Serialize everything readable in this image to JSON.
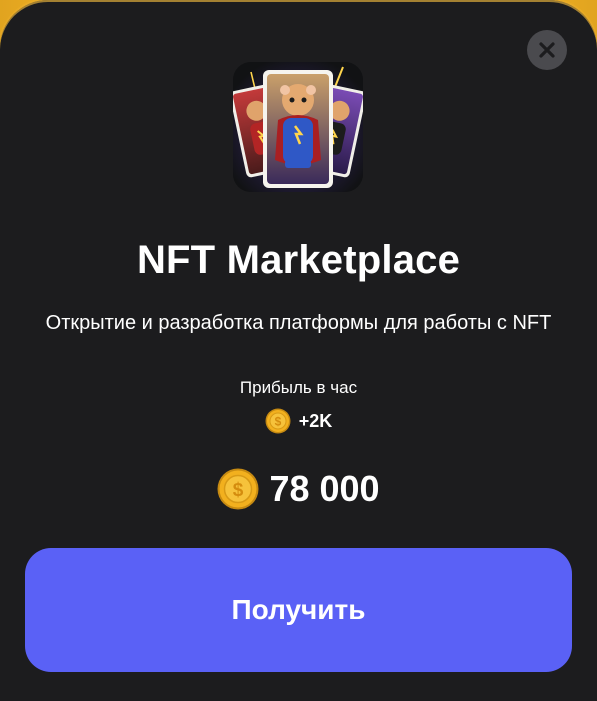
{
  "modal": {
    "title": "NFT Marketplace",
    "description": "Открытие и разработка платформы для работы с NFT",
    "profit_label": "Прибыль в час",
    "profit_value": "+2K",
    "price": "78 000",
    "cta_label": "Получить"
  },
  "icons": {
    "close": "close-icon",
    "coin": "coin-icon",
    "hero": "nft-cards-hamster-image"
  },
  "colors": {
    "background": "#1c1c1e",
    "accent_button": "#5a61f6",
    "coin_gold": "#f2b01e",
    "close_bg": "#4a4a4e",
    "sheet_border_glow": "#f6c443"
  }
}
